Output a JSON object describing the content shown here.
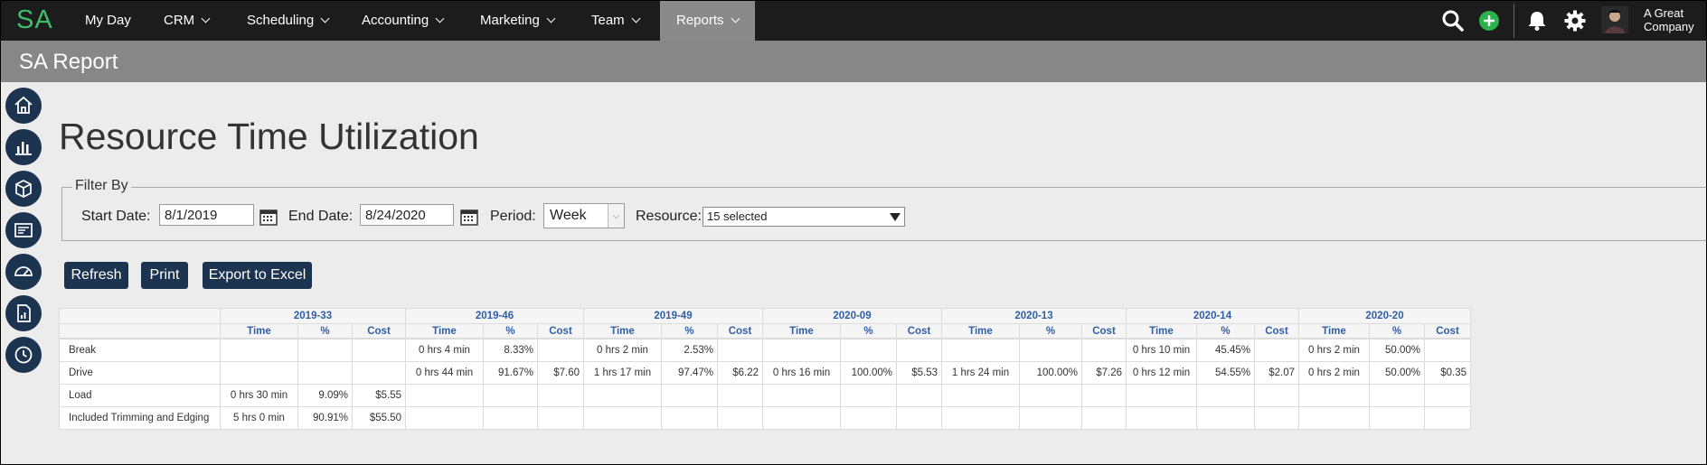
{
  "app": {
    "logo_text": "SA",
    "nav": [
      {
        "label": "My Day",
        "has_menu": false
      },
      {
        "label": "CRM",
        "has_menu": true
      },
      {
        "label": "Scheduling",
        "has_menu": true
      },
      {
        "label": "Accounting",
        "has_menu": true
      },
      {
        "label": "Marketing",
        "has_menu": true
      },
      {
        "label": "Team",
        "has_menu": true
      },
      {
        "label": "Reports",
        "has_menu": true,
        "active": true
      }
    ],
    "company_line1": "A Great",
    "company_line2": "Company",
    "icons": [
      "search-icon",
      "add-icon",
      "bell-icon",
      "gear-icon",
      "avatar"
    ]
  },
  "header": {
    "title": "SA Report"
  },
  "rail": [
    "home-icon",
    "chart-icon",
    "box-icon",
    "invoice-icon",
    "gauge-icon",
    "report-icon",
    "clock-icon"
  ],
  "page": {
    "title": "Resource Time Utilization"
  },
  "filter": {
    "legend": "Filter By",
    "start_label": "Start Date:",
    "start_value": "8/1/2019",
    "end_label": "End Date:",
    "end_value": "8/24/2020",
    "period_label": "Period:",
    "period_value": "Week",
    "resource_label": "Resource:",
    "resource_value": "15 selected"
  },
  "buttons": {
    "refresh": "Refresh",
    "print": "Print",
    "export": "Export to Excel"
  },
  "table": {
    "periods": [
      "2019-33",
      "2019-46",
      "2019-49",
      "2020-09",
      "2020-13",
      "2020-14",
      "2020-20"
    ],
    "subheaders": {
      "time": "Time",
      "pct": "%",
      "cost": "Cost"
    },
    "rows": [
      {
        "label": "Break",
        "cells": [
          [
            "",
            "",
            ""
          ],
          [
            "0 hrs 4 min",
            "8.33%",
            ""
          ],
          [
            "0 hrs 2 min",
            "2.53%",
            ""
          ],
          [
            "",
            "",
            ""
          ],
          [
            "",
            "",
            ""
          ],
          [
            "0 hrs 10 min",
            "45.45%",
            ""
          ],
          [
            "0 hrs 2 min",
            "50.00%",
            ""
          ]
        ]
      },
      {
        "label": "Drive",
        "cells": [
          [
            "",
            "",
            ""
          ],
          [
            "0 hrs 44 min",
            "91.67%",
            "$7.60"
          ],
          [
            "1 hrs 17 min",
            "97.47%",
            "$6.22"
          ],
          [
            "0 hrs 16 min",
            "100.00%",
            "$5.53"
          ],
          [
            "1 hrs 24 min",
            "100.00%",
            "$7.26"
          ],
          [
            "0 hrs 12 min",
            "54.55%",
            "$2.07"
          ],
          [
            "0 hrs 2 min",
            "50.00%",
            "$0.35"
          ]
        ]
      },
      {
        "label": "Load",
        "cells": [
          [
            "0 hrs 30 min",
            "9.09%",
            "$5.55"
          ],
          [
            "",
            "",
            ""
          ],
          [
            "",
            "",
            ""
          ],
          [
            "",
            "",
            ""
          ],
          [
            "",
            "",
            ""
          ],
          [
            "",
            "",
            ""
          ],
          [
            "",
            "",
            ""
          ]
        ]
      },
      {
        "label": "Included Trimming and Edging",
        "cells": [
          [
            "5 hrs 0 min",
            "90.91%",
            "$55.50"
          ],
          [
            "",
            "",
            ""
          ],
          [
            "",
            "",
            ""
          ],
          [
            "",
            "",
            ""
          ],
          [
            "",
            "",
            ""
          ],
          [
            "",
            "",
            ""
          ],
          [
            "",
            "",
            ""
          ]
        ]
      }
    ]
  }
}
